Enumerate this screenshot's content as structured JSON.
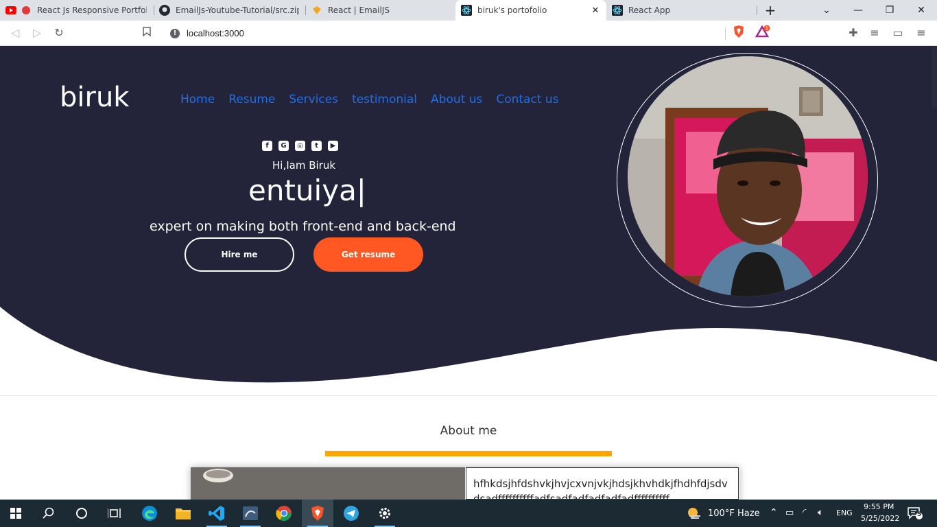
{
  "browser": {
    "tabs": [
      {
        "title": "React Js Responsive Portfolio w",
        "favicon": "youtube-icon"
      },
      {
        "title": "EmailJs-Youtube-Tutorial/src.zip at",
        "favicon": "github-icon"
      },
      {
        "title": "React | EmailJS",
        "favicon": "emailjs-icon"
      },
      {
        "title": "biruk's portofolio",
        "favicon": "react-icon",
        "active": true
      },
      {
        "title": "React App",
        "favicon": "react-icon"
      }
    ],
    "url": "localhost:3000"
  },
  "site": {
    "logo": "biruk",
    "nav": [
      "Home",
      "Resume",
      "Services",
      "testimonial",
      "About us",
      "Contact us"
    ],
    "social_icons": [
      "facebook-icon",
      "google-plus-icon",
      "instagram-icon",
      "twitter-icon",
      "youtube-icon"
    ],
    "greeting": "Hi,Iam Biruk",
    "typed_text": "entuiya|",
    "tagline": "expert on making both front-end and back-end",
    "hire_label": "Hire me",
    "resume_label": "Get resume",
    "about_title": "About me",
    "about_text": "hfhkdsjhfdshvkjhvjcxvnjvkjhdsjkhvhdkjfhdhfdjsdvdsadffffffffffadfsadfadfadfadfadffffffffff",
    "colors": {
      "hero_bg": "#23233a",
      "nav_link": "#1f6feb",
      "accent": "#ff5823",
      "about_bar": "#ffa500"
    }
  },
  "taskbar": {
    "weather_temp": "100°F",
    "weather_desc": "Haze",
    "language": "ENG",
    "time": "9:55 PM",
    "date": "5/25/2022",
    "notification_count": "5"
  }
}
